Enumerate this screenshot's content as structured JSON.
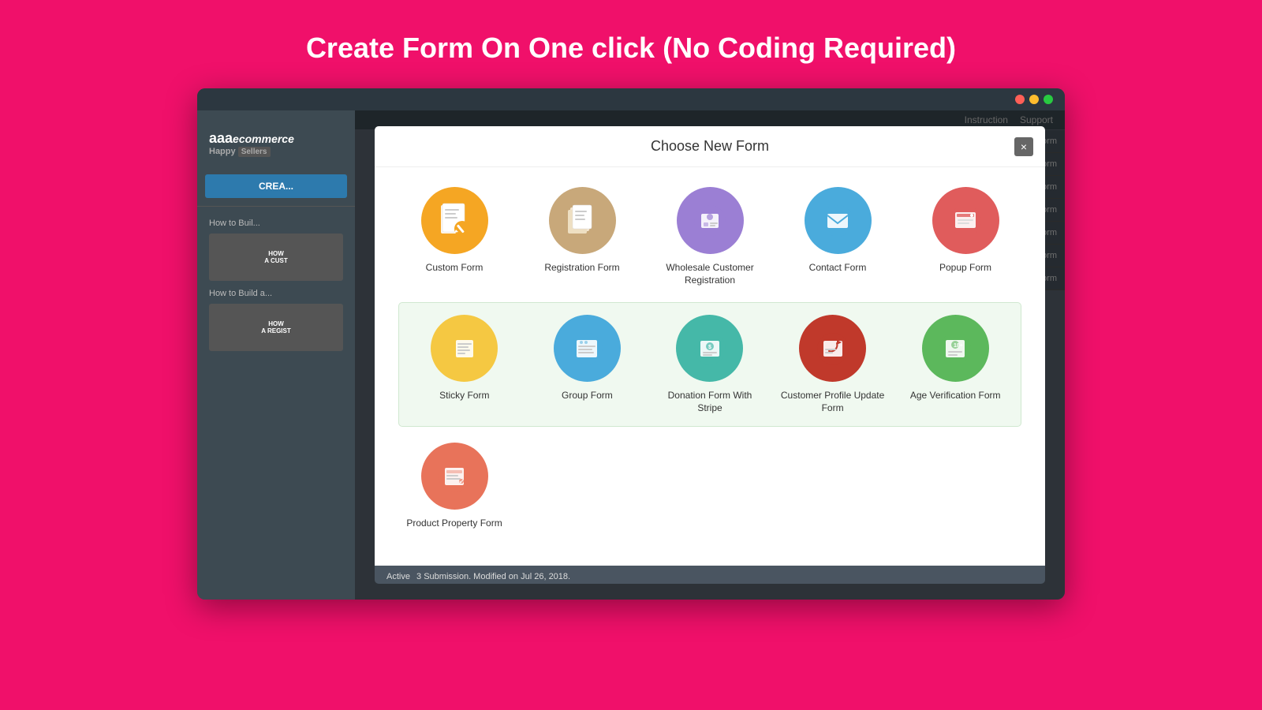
{
  "page": {
    "title": "Create Form On One click (No Coding Required)",
    "bg_color": "#F0106A"
  },
  "browser": {
    "titlebar_color": "#2c3740"
  },
  "sidebar": {
    "logo_aaa": "aaa",
    "logo_commerce": "ecommerce",
    "logo_tagline": "Happy",
    "logo_badge": "Sellers",
    "create_btn": "CREA...",
    "hw1_label": "How to Buil...",
    "hw1_sub1": "HOW",
    "hw1_sub2": "A CUST",
    "hw2_label": "How to Build a...",
    "hw2_sub1": "HOW",
    "hw2_sub2": "A REGIST"
  },
  "topnav": {
    "instruction": "Instruction",
    "support": "Support"
  },
  "modal": {
    "title": "Choose New Form",
    "close_label": "×"
  },
  "form_types_row1": [
    {
      "id": "custom-form",
      "label": "Custom Form",
      "icon_color": "#F5A623",
      "icon_char": "📝"
    },
    {
      "id": "registration-form",
      "label": "Registration Form",
      "icon_color": "#D4A06A",
      "icon_char": "📄"
    },
    {
      "id": "wholesale-form",
      "label": "Wholesale Customer Registration",
      "icon_color": "#9B7FD4",
      "icon_char": "📦"
    },
    {
      "id": "contact-form",
      "label": "Contact Form",
      "icon_color": "#4AABDC",
      "icon_char": "✉️"
    },
    {
      "id": "popup-form",
      "label": "Popup Form",
      "icon_color": "#E05C5C",
      "icon_char": "🔴"
    }
  ],
  "form_types_row2": [
    {
      "id": "sticky-form",
      "label": "Sticky Form",
      "icon_color": "#F5C842",
      "icon_char": "📋"
    },
    {
      "id": "group-form",
      "label": "Group Form",
      "icon_color": "#4AABDC",
      "icon_char": "🗂️"
    },
    {
      "id": "donation-form",
      "label": "Donation Form With Stripe",
      "icon_color": "#45B8A8",
      "icon_char": "💰"
    },
    {
      "id": "customer-profile-form",
      "label": "Customer Profile Update Form",
      "icon_color": "#C0392B",
      "icon_char": "🔄"
    },
    {
      "id": "age-verification-form",
      "label": "Age Verification Form",
      "icon_color": "#5CB85C",
      "icon_char": "🪪"
    }
  ],
  "form_types_row3": [
    {
      "id": "product-property-form",
      "label": "Product Property Form",
      "icon_color": "#E8735A",
      "icon_char": "🛒"
    }
  ],
  "duplicate_btns": [
    "Duplicate Form",
    "Duplicate Form",
    "Duplicate Form",
    "Duplicate Form",
    "Duplicate Form",
    "Duplicate Form",
    "Duplicate Form"
  ],
  "bottom_bar": {
    "status": "Active",
    "submission_info": "3 Submission. Modified on Jul 26, 2018."
  }
}
